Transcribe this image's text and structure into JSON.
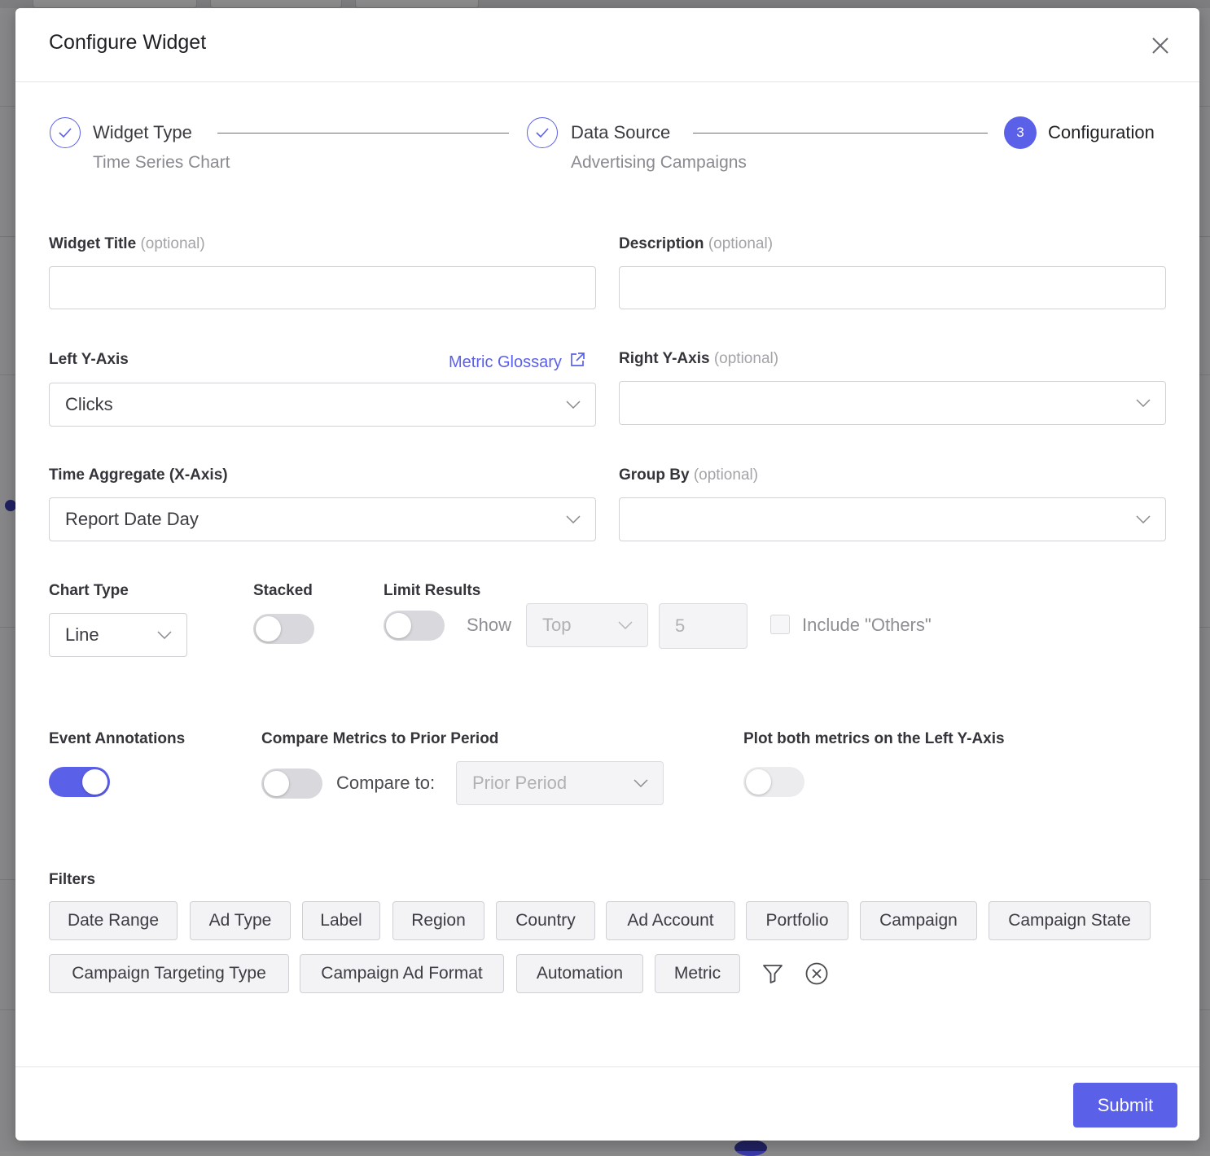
{
  "modal": {
    "title": "Configure Widget",
    "close_icon": "close-icon"
  },
  "stepper": {
    "steps": [
      {
        "title": "Widget Type",
        "subtitle": "Time Series Chart",
        "state": "complete"
      },
      {
        "title": "Data Source",
        "subtitle": "Advertising Campaigns",
        "state": "complete"
      },
      {
        "title": "Configuration",
        "number": "3",
        "state": "active"
      }
    ]
  },
  "form": {
    "widget_title": {
      "label": "Widget Title",
      "optional": "(optional)",
      "value": ""
    },
    "description": {
      "label": "Description",
      "optional": "(optional)",
      "value": ""
    },
    "left_y_axis": {
      "label": "Left Y-Axis",
      "value": "Clicks",
      "link": "Metric Glossary"
    },
    "right_y_axis": {
      "label": "Right Y-Axis",
      "optional": "(optional)",
      "value": ""
    },
    "time_aggregate": {
      "label": "Time Aggregate (X-Axis)",
      "value": "Report Date Day"
    },
    "group_by": {
      "label": "Group By",
      "optional": "(optional)",
      "value": ""
    },
    "chart_type": {
      "label": "Chart Type",
      "value": "Line"
    },
    "stacked": {
      "label": "Stacked",
      "on": false
    },
    "limit_results": {
      "label": "Limit Results",
      "on": false,
      "show_label": "Show",
      "direction": "Top",
      "count": "5",
      "include_others": "Include \"Others\"",
      "include_others_checked": false
    },
    "event_annotations": {
      "label": "Event Annotations",
      "on": true
    },
    "compare_metrics": {
      "label": "Compare Metrics to Prior Period",
      "on": false,
      "compare_to_label": "Compare to:",
      "compare_to_value": "Prior Period"
    },
    "plot_both": {
      "label": "Plot both metrics on the Left Y-Axis",
      "on": false
    }
  },
  "filters": {
    "label": "Filters",
    "row1": [
      "Date Range",
      "Ad Type",
      "Label",
      "Region",
      "Country",
      "Ad Account",
      "Portfolio",
      "Campaign",
      "Campaign State"
    ],
    "row2": [
      "Campaign Targeting Type",
      "Campaign Ad Format",
      "Automation",
      "Metric"
    ]
  },
  "footer": {
    "submit_label": "Submit"
  },
  "colors": {
    "accent": "#5b60e8"
  }
}
